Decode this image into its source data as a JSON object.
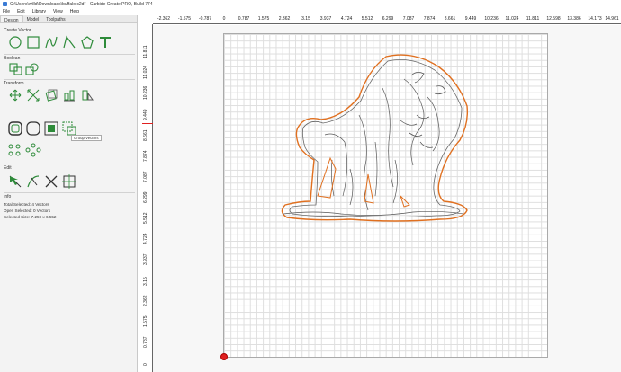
{
  "window": {
    "title": "C:\\Users\\willd\\Downloads\\buffalo.c2d* - Carbide Create PRO, Build 774"
  },
  "menu": [
    "File",
    "Edit",
    "Library",
    "View",
    "Help"
  ],
  "tabs": [
    {
      "label": "Design",
      "active": true
    },
    {
      "label": "Model",
      "active": false
    },
    {
      "label": "Toolpaths",
      "active": false
    }
  ],
  "sections": {
    "create_vector": "Create Vector",
    "boolean": "Boolean",
    "transform": "Transform",
    "edit": "Edit",
    "info": "Info"
  },
  "tooltip": "Group Vectors",
  "info": {
    "total_selected": "Total Selected:   4 Vectors",
    "open_selected": "Open Selected:   0 Vectors",
    "selected_size": "Selected Size:    7.259 x 6.552"
  },
  "ruler_x": [
    "-2.362",
    "-1.575",
    "-0.787",
    "0",
    "0.787",
    "1.575",
    "2.362",
    "3.15",
    "3.937",
    "4.724",
    "5.512",
    "6.299",
    "7.087",
    "7.874",
    "8.661",
    "9.449",
    "10.236",
    "11.024",
    "11.811",
    "12.598",
    "13.386",
    "14.173",
    "14.961"
  ],
  "ruler_y": [
    "11.811",
    "11.024",
    "10.236",
    "9.449",
    "8.661",
    "7.874",
    "7.087",
    "6.299",
    "5.512",
    "4.724",
    "3.937",
    "3.15",
    "2.362",
    "1.575",
    "0.787",
    "0"
  ],
  "colors": {
    "accent": "#2e8b3a",
    "selection": "#e07020",
    "vector": "#555555",
    "origin": "#e02020"
  },
  "icons": {
    "create": [
      "circle-icon",
      "rectangle-icon",
      "curve-icon",
      "polyline-icon",
      "polygon-icon",
      "text-icon"
    ],
    "boolean": [
      "weld-icon",
      "union-icon"
    ],
    "transform": [
      "move-icon",
      "scale-icon",
      "rotate-icon",
      "align-icon",
      "mirror-icon",
      "offset-icon",
      "fillet-icon",
      "group-icon",
      "ungroup-icon",
      "group-vectors-icon",
      "grid-array-icon",
      "circular-array-icon"
    ],
    "edit": [
      "node-edit-icon",
      "trim-icon",
      "cut-icon",
      "join-icon"
    ]
  }
}
